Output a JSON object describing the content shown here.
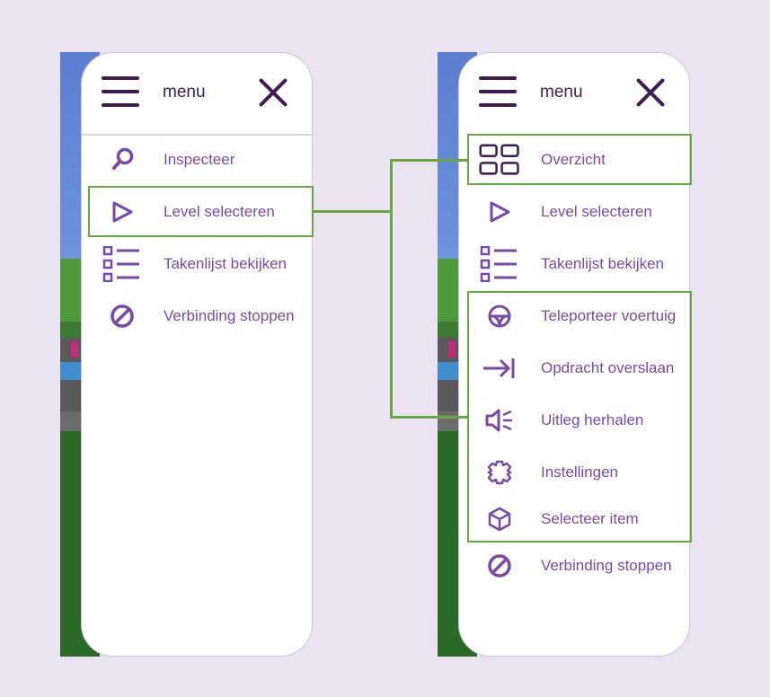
{
  "left_panel": {
    "title": "menu",
    "items": [
      {
        "label": "Inspecteer",
        "icon": "magnifier-icon"
      },
      {
        "label": "Level selecteren",
        "icon": "play-triangle-icon"
      },
      {
        "label": "Takenlijst bekijken",
        "icon": "checklist-icon"
      },
      {
        "label": "Verbinding stoppen",
        "icon": "disconnect-icon"
      }
    ]
  },
  "right_panel": {
    "title": "menu",
    "items": [
      {
        "label": "Overzicht",
        "icon": "grid-icon"
      },
      {
        "label": "Level selecteren",
        "icon": "play-triangle-icon"
      },
      {
        "label": "Takenlijst bekijken",
        "icon": "checklist-icon"
      },
      {
        "label": "Teleporteer voertuig",
        "icon": "steering-wheel-icon"
      },
      {
        "label": "Opdracht overslaan",
        "icon": "skip-arrow-icon"
      },
      {
        "label": "Uitleg herhalen",
        "icon": "speaker-icon"
      },
      {
        "label": "Instellingen",
        "icon": "gear-icon"
      },
      {
        "label": "Selecteer item",
        "icon": "cube-icon"
      },
      {
        "label": "Verbinding stoppen",
        "icon": "disconnect-icon"
      }
    ]
  },
  "colors": {
    "background": "#ebe3f2",
    "icon": "#7a49a6",
    "header_icon": "#3d1e52",
    "highlight": "#69a840"
  }
}
